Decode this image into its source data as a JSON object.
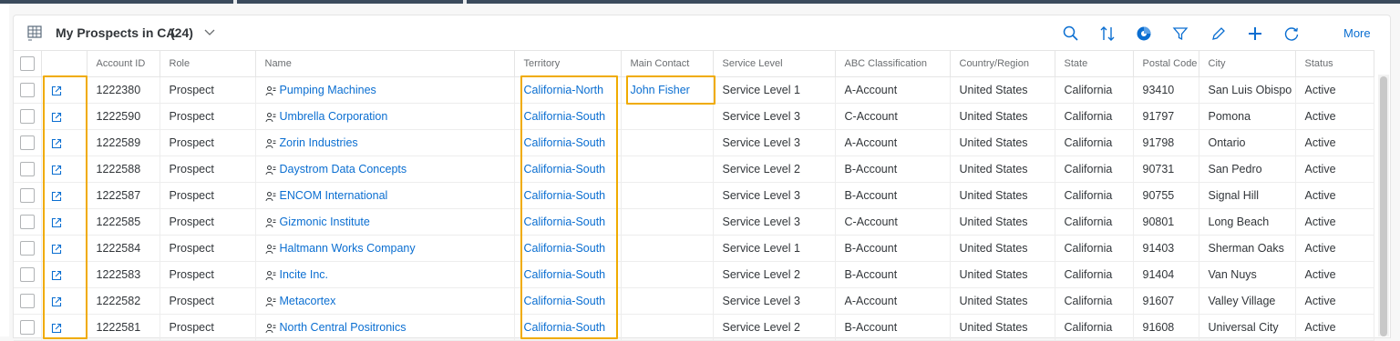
{
  "toolbar": {
    "title": "My Prospects in CA",
    "count": "(24)",
    "more_label": "More",
    "icons": [
      "search-icon",
      "sort-icon",
      "chart-icon",
      "filter-icon",
      "edit-icon",
      "add-icon",
      "refresh-icon"
    ]
  },
  "columns": [
    "",
    "",
    "Account ID",
    "Role",
    "Name",
    "Territory",
    "Main Contact",
    "Service Level",
    "ABC Classification",
    "Country/Region",
    "State",
    "Postal Code",
    "City",
    "Status"
  ],
  "rows": [
    {
      "id": "1222380",
      "role": "Prospect",
      "name": "Pumping Machines",
      "territory": "California-North",
      "contact": "John Fisher",
      "service": "Service Level 1",
      "abc": "A-Account",
      "country": "United States",
      "state": "California",
      "postal": "93410",
      "city": "San Luis Obispo",
      "status": "Active"
    },
    {
      "id": "1222590",
      "role": "Prospect",
      "name": "Umbrella Corporation",
      "territory": "California-South",
      "contact": "",
      "service": "Service Level 3",
      "abc": "C-Account",
      "country": "United States",
      "state": "California",
      "postal": "91797",
      "city": "Pomona",
      "status": "Active"
    },
    {
      "id": "1222589",
      "role": "Prospect",
      "name": "Zorin Industries",
      "territory": "California-South",
      "contact": "",
      "service": "Service Level 3",
      "abc": "A-Account",
      "country": "United States",
      "state": "California",
      "postal": "91798",
      "city": "Ontario",
      "status": "Active"
    },
    {
      "id": "1222588",
      "role": "Prospect",
      "name": "Daystrom Data Concepts",
      "territory": "California-South",
      "contact": "",
      "service": "Service Level 2",
      "abc": "B-Account",
      "country": "United States",
      "state": "California",
      "postal": "90731",
      "city": "San Pedro",
      "status": "Active"
    },
    {
      "id": "1222587",
      "role": "Prospect",
      "name": "ENCOM International",
      "territory": "California-South",
      "contact": "",
      "service": "Service Level 3",
      "abc": "B-Account",
      "country": "United States",
      "state": "California",
      "postal": "90755",
      "city": "Signal Hill",
      "status": "Active"
    },
    {
      "id": "1222585",
      "role": "Prospect",
      "name": "Gizmonic Institute",
      "territory": "California-South",
      "contact": "",
      "service": "Service Level 3",
      "abc": "C-Account",
      "country": "United States",
      "state": "California",
      "postal": "90801",
      "city": "Long Beach",
      "status": "Active"
    },
    {
      "id": "1222584",
      "role": "Prospect",
      "name": "Haltmann Works Company",
      "territory": "California-South",
      "contact": "",
      "service": "Service Level 1",
      "abc": "B-Account",
      "country": "United States",
      "state": "California",
      "postal": "91403",
      "city": "Sherman Oaks",
      "status": "Active"
    },
    {
      "id": "1222583",
      "role": "Prospect",
      "name": "Incite Inc.",
      "territory": "California-South",
      "contact": "",
      "service": "Service Level 2",
      "abc": "B-Account",
      "country": "United States",
      "state": "California",
      "postal": "91404",
      "city": "Van Nuys",
      "status": "Active"
    },
    {
      "id": "1222582",
      "role": "Prospect",
      "name": "Metacortex",
      "territory": "California-South",
      "contact": "",
      "service": "Service Level 3",
      "abc": "A-Account",
      "country": "United States",
      "state": "California",
      "postal": "91607",
      "city": "Valley Village",
      "status": "Active"
    },
    {
      "id": "1222581",
      "role": "Prospect",
      "name": "North Central Positronics",
      "territory": "California-South",
      "contact": "",
      "service": "Service Level 2",
      "abc": "B-Account",
      "country": "United States",
      "state": "California",
      "postal": "91608",
      "city": "Universal City",
      "status": "Active"
    }
  ],
  "colors": {
    "link": "#0a6ed1",
    "highlight": "#f0ab00"
  }
}
